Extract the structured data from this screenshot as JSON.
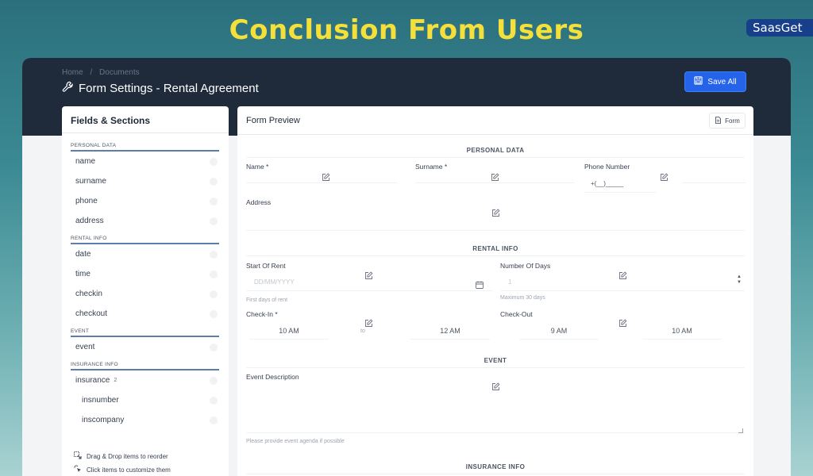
{
  "banner": {
    "title": "Conclusion From Users",
    "brand": "SaasGet"
  },
  "header": {
    "breadcrumb": [
      "Home",
      "/",
      "Documents"
    ],
    "title": "Form Settings - Rental Agreement",
    "save_label": "Save All"
  },
  "sidebar": {
    "title": "Fields & Sections",
    "sections": [
      {
        "label": "PERSONAL DATA",
        "items": [
          "name",
          "surname",
          "phone",
          "address"
        ]
      },
      {
        "label": "RENTAL INFO",
        "items": [
          "date",
          "time",
          "checkin",
          "checkout"
        ]
      },
      {
        "label": "EVENT",
        "items": [
          "event"
        ]
      },
      {
        "label": "INSURANCE INFO",
        "items": [
          "insurance",
          "insnumber",
          "inscompany"
        ]
      }
    ],
    "insurance_badge": "2",
    "hints": [
      "Drag & Drop items to reorder",
      "Click items to customize them"
    ]
  },
  "preview": {
    "title": "Form Preview",
    "form_button": "Form",
    "personal_section": "PERSONAL DATA",
    "name_label": "Name *",
    "surname_label": "Surname *",
    "phone_label": "Phone Number",
    "phone_placeholder": "+(__)_____",
    "address_label": "Address",
    "rental_section": "RENTAL INFO",
    "start_label": "Start Of Rent",
    "start_placeholder": "DD/MM/YYYY",
    "start_hint": "First days of rent",
    "days_label": "Number Of Days",
    "days_value": "1",
    "days_hint": "Maximum 30 days",
    "checkin_label": "Check-In *",
    "checkin_from": "10 AM",
    "checkin_sep": "to",
    "checkin_to": "12 AM",
    "checkout_label": "Check-Out",
    "checkout_from": "9 AM",
    "checkout_to": "10 AM",
    "event_section": "EVENT",
    "event_label": "Event Description",
    "event_hint": "Please provide event agenda if possible",
    "insurance_section": "INSURANCE INFO"
  }
}
